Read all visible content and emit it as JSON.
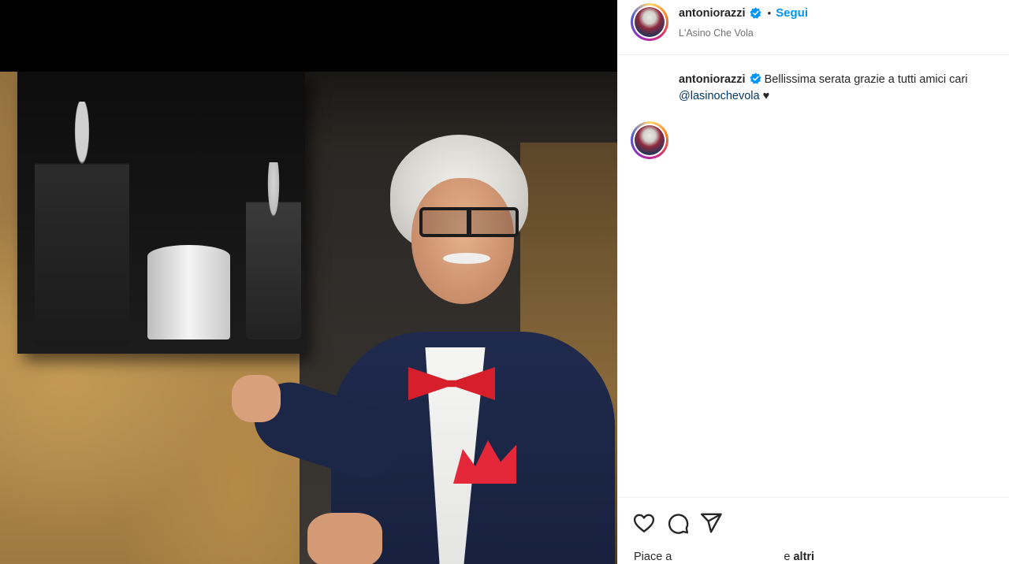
{
  "post": {
    "author": {
      "username": "antoniorazzi",
      "verified": true,
      "location": "L'Asino Che Vola"
    },
    "follow_label": "Segui",
    "separator": "•",
    "caption": {
      "text": "Bellissima serata grazie a tutti amici cari",
      "mention": "@lasinochevola",
      "suffix": " ♥"
    },
    "actions": {
      "like_icon": "heart-icon",
      "comment_icon": "comment-icon",
      "share_icon": "share-icon"
    },
    "likes": {
      "prefix": "Piace a",
      "joiner": "e",
      "others": "altri"
    }
  },
  "colors": {
    "link_blue": "#0095f6",
    "mention_blue": "#00376b",
    "text": "#262626",
    "muted": "#737373",
    "divider": "#efefef",
    "verified_blue": "#0095f6"
  }
}
